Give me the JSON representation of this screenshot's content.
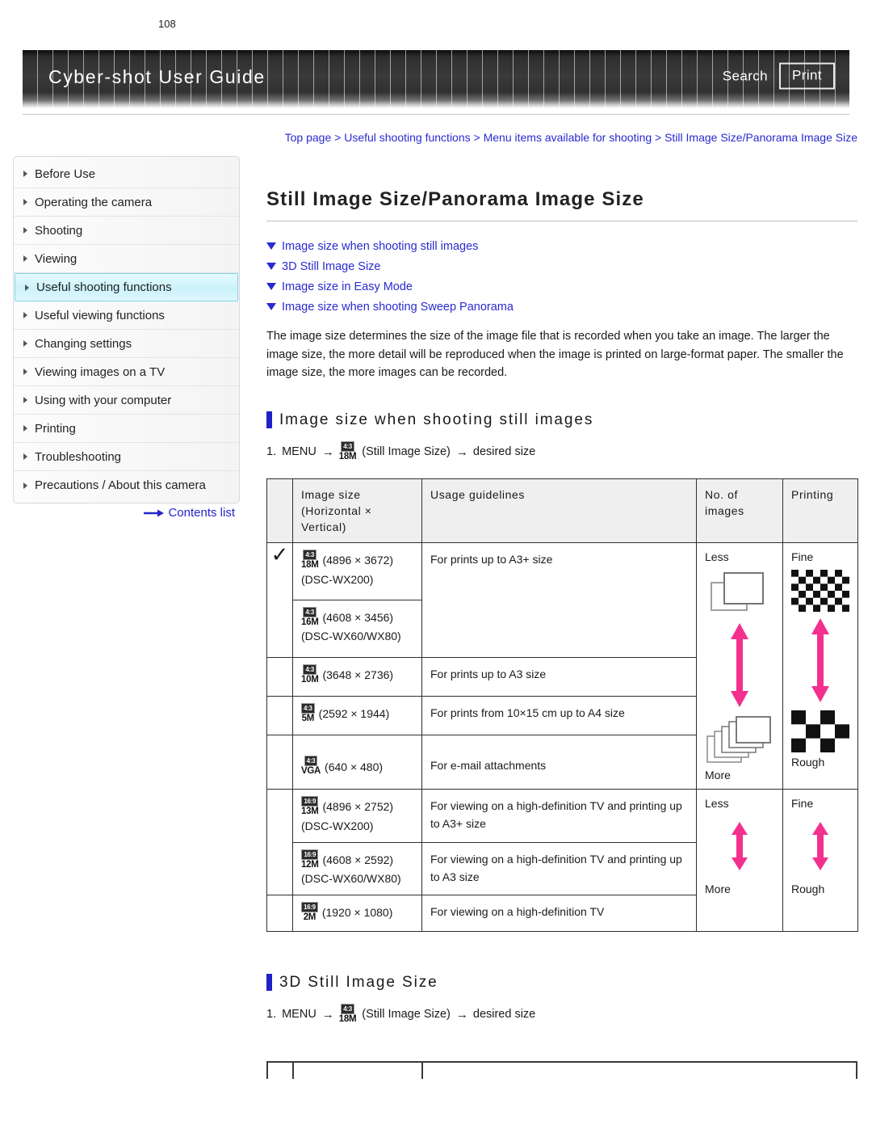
{
  "header": {
    "title": "Cyber-shot User Guide",
    "search_label": "Search",
    "print_label": "Print"
  },
  "sidebar": {
    "items": [
      {
        "label": "Before Use",
        "active": false
      },
      {
        "label": "Operating the camera",
        "active": false
      },
      {
        "label": "Shooting",
        "active": false
      },
      {
        "label": "Viewing",
        "active": false
      },
      {
        "label": "Useful shooting functions",
        "active": true
      },
      {
        "label": "Useful viewing functions",
        "active": false
      },
      {
        "label": "Changing settings",
        "active": false
      },
      {
        "label": "Viewing images on a TV",
        "active": false
      },
      {
        "label": "Using with your computer",
        "active": false
      },
      {
        "label": "Printing",
        "active": false
      },
      {
        "label": "Troubleshooting",
        "active": false
      },
      {
        "label": "Precautions / About this camera",
        "active": false
      }
    ],
    "contents_link": "Contents list"
  },
  "main": {
    "breadcrumb": "Top page > Useful shooting functions > Menu items available for shooting > Still Image Size/Panorama Image Size",
    "page_title": "Still Image Size/Panorama Image Size",
    "anchors": [
      "Image size when shooting still images",
      "3D Still Image Size",
      "Image size in Easy Mode",
      "Image size when shooting Sweep Panorama"
    ],
    "intro": "The image size determines the size of the image file that is recorded when you take an image. The larger the image size, the more detail will be reproduced when the image is printed on large-format paper. The smaller the image size, the more images can be recorded.",
    "section1": {
      "heading": "Image size when shooting still images",
      "step_number": "1.",
      "step_menu": "MENU",
      "step_arrow1": "→",
      "step_badge_ratio": "4:3",
      "step_badge_mp": "18M",
      "step_label": "(Still Image Size)",
      "step_arrow2": "→",
      "step_tail": "desired size"
    },
    "section2": {
      "heading": "3D Still Image Size",
      "step_number": "1.",
      "step_menu": "MENU",
      "step_arrow1": "→",
      "step_badge_ratio": "4:3",
      "step_badge_mp": "18M",
      "step_label": "(Still Image Size)",
      "step_arrow2": "→",
      "step_tail": "desired size"
    },
    "table": {
      "headers": {
        "check": "",
        "size": "Image size (Horizontal × Vertical)",
        "usage": "Usage guidelines",
        "count": "No. of images",
        "printing": "Printing"
      },
      "rows": [
        {
          "checked": true,
          "ratio": "4:3",
          "mp": "18M",
          "dims": "(4896 × 3672)",
          "model": "(DSC-WX200)",
          "usage": "For prints up to A3+ size"
        },
        {
          "checked": false,
          "ratio": "4:3",
          "mp": "16M",
          "dims": "(4608 × 3456)",
          "model": "(DSC-WX60/WX80)",
          "usage": ""
        },
        {
          "checked": false,
          "ratio": "4:3",
          "mp": "10M",
          "dims": "(3648 × 2736)",
          "model": "",
          "usage": "For prints up to A3 size"
        },
        {
          "checked": false,
          "ratio": "4:3",
          "mp": "5M",
          "dims": "(2592 × 1944)",
          "model": "",
          "usage": "For prints from 10×15 cm up to A4 size"
        },
        {
          "checked": false,
          "ratio": "4:3",
          "mp": "VGA",
          "dims": "(640 × 480)",
          "model": "",
          "usage": "For e-mail attachments"
        },
        {
          "checked": false,
          "ratio": "16:9",
          "mp": "13M",
          "dims": "(4896 × 2752)",
          "model": "(DSC-WX200)",
          "usage": "For viewing on a high-definition TV and printing up to A3+ size"
        },
        {
          "checked": false,
          "ratio": "16:9",
          "mp": "12M",
          "dims": "(4608 × 2592)",
          "model": "(DSC-WX60/WX80)",
          "usage": "For viewing on a high-definition TV and printing up to A3 size"
        },
        {
          "checked": false,
          "ratio": "16:9",
          "mp": "2M",
          "dims": "(1920 × 1080)",
          "model": "",
          "usage": "For viewing on a high-definition TV"
        }
      ],
      "scale_labels": {
        "count_top": "Less",
        "count_bottom": "More",
        "print_top": "Fine",
        "print_bottom": "Rough"
      }
    }
  },
  "footer": {
    "page_number": "108"
  },
  "colors": {
    "link": "#2a2ad0",
    "accent_bar": "#2020c8",
    "arrow_pink": "#f4308f",
    "sidebar_active": "#ccf2fb",
    "header_dark": "#303030"
  }
}
